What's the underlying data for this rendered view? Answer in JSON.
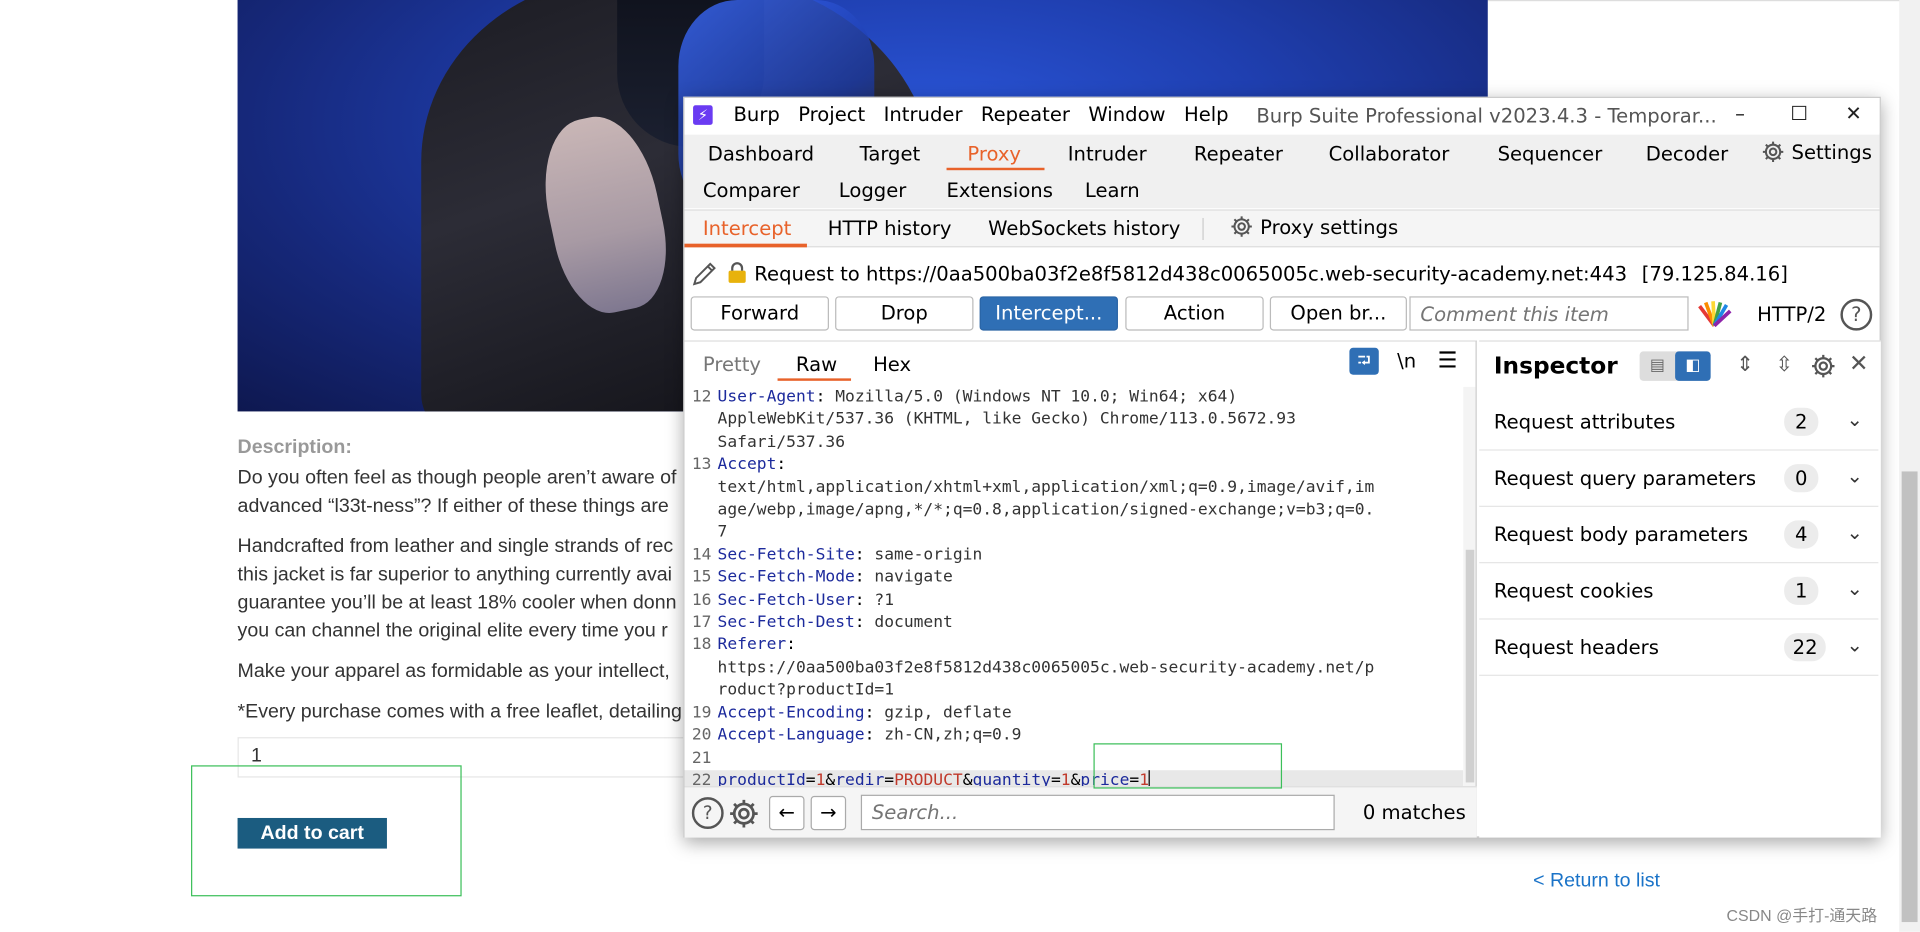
{
  "webpage": {
    "description_label": "Description:",
    "desc_lines": [
      "Do you often feel as though people aren’t aware of",
      "advanced “l33t-ness”? If either of these things are",
      "Handcrafted from leather and single strands of rec",
      "this jacket is far superior to anything currently avai",
      "guarantee you’ll be at least 18% cooler when donn",
      "you can channel the original elite every time you r",
      "Make your apparel as formidable as your intellect,",
      "*Every purchase comes with a free leaflet, detailing"
    ],
    "quantity_value": "1",
    "add_to_cart": "Add to cart",
    "return_link": "< Return to list",
    "watermark": "CSDN @手打-通天路"
  },
  "burp": {
    "logo_glyph": "⚡",
    "menu": [
      "Burp",
      "Project",
      "Intruder",
      "Repeater",
      "Window",
      "Help"
    ],
    "window_title": "Burp Suite Professional v2023.4.3 - Temporar...",
    "window_controls": {
      "minimize": "–",
      "maximize": "☐",
      "close": "✕"
    },
    "tabs_row1": [
      "Dashboard",
      "Target",
      "Proxy",
      "Intruder",
      "Repeater",
      "Collaborator",
      "Sequencer",
      "Decoder"
    ],
    "settings_label": "Settings",
    "tabs_row2": [
      "Comparer",
      "Logger",
      "Extensions",
      "Learn"
    ],
    "active_tab": "Proxy",
    "proxy_tabs": [
      "Intercept",
      "HTTP history",
      "WebSockets history"
    ],
    "proxy_settings": "Proxy settings",
    "request_line": "Request to https://0aa500ba03f2e8f5812d438c0065005c.web-security-academy.net:443",
    "request_ip": "[79.125.84.16]",
    "buttons": {
      "forward": "Forward",
      "drop": "Drop",
      "intercept": "Intercept...",
      "action": "Action",
      "open_browser": "Open br..."
    },
    "comment_placeholder": "Comment this item",
    "http_version": "HTTP/2",
    "view_tabs": [
      "Pretty",
      "Raw",
      "Hex"
    ],
    "newline_toggle": "\\n",
    "code": {
      "l12_num": "12",
      "l12_key": "User-Agent",
      "l12_val": " Mozilla/5.0 (Windows NT 10.0; Win64; x64)",
      "l12_cont1": "AppleWebKit/537.36 (KHTML, like Gecko) Chrome/113.0.5672.93",
      "l12_cont2": "Safari/537.36",
      "l13_num": "13",
      "l13_key": "Accept",
      "l13_cont1": "text/html,application/xhtml+xml,application/xml;q=0.9,image/avif,im",
      "l13_cont2": "age/webp,image/apng,*/*;q=0.8,application/signed-exchange;v=b3;q=0.",
      "l13_cont3": "7",
      "l14_num": "14",
      "l14_key": "Sec-Fetch-Site",
      "l14_val": " same-origin",
      "l15_num": "15",
      "l15_key": "Sec-Fetch-Mode",
      "l15_val": " navigate",
      "l16_num": "16",
      "l16_key": "Sec-Fetch-User",
      "l16_val": " ?1",
      "l17_num": "17",
      "l17_key": "Sec-Fetch-Dest",
      "l17_val": " document",
      "l18_num": "18",
      "l18_key": "Referer",
      "l18_cont1": "https://0aa500ba03f2e8f5812d438c0065005c.web-security-academy.net/p",
      "l18_cont2": "roduct?productId=1",
      "l19_num": "19",
      "l19_key": "Accept-Encoding",
      "l19_val": " gzip, deflate",
      "l20_num": "20",
      "l20_key": "Accept-Language",
      "l20_val": " zh-CN,zh;q=0.9",
      "l21_num": "21",
      "l22_num": "22",
      "body": {
        "k1": "productId",
        "v1": "1",
        "k2": "redir",
        "v2": "PRODUCT",
        "k3": "quantity",
        "v3": "1",
        "k4": "price",
        "v4": "1"
      }
    },
    "search_placeholder": "Search...",
    "matches": "0 matches",
    "inspector": {
      "title": "Inspector",
      "rows": [
        {
          "label": "Request attributes",
          "count": "2"
        },
        {
          "label": "Request query parameters",
          "count": "0"
        },
        {
          "label": "Request body parameters",
          "count": "4"
        },
        {
          "label": "Request cookies",
          "count": "1"
        },
        {
          "label": "Request headers",
          "count": "22"
        }
      ]
    }
  },
  "colors": {
    "accent": "#e8622a",
    "primary_button": "#2f6fb5",
    "header_key": "#1c2a9c",
    "param_value": "#c0392b",
    "highlight_box": "#3cbf5a"
  }
}
